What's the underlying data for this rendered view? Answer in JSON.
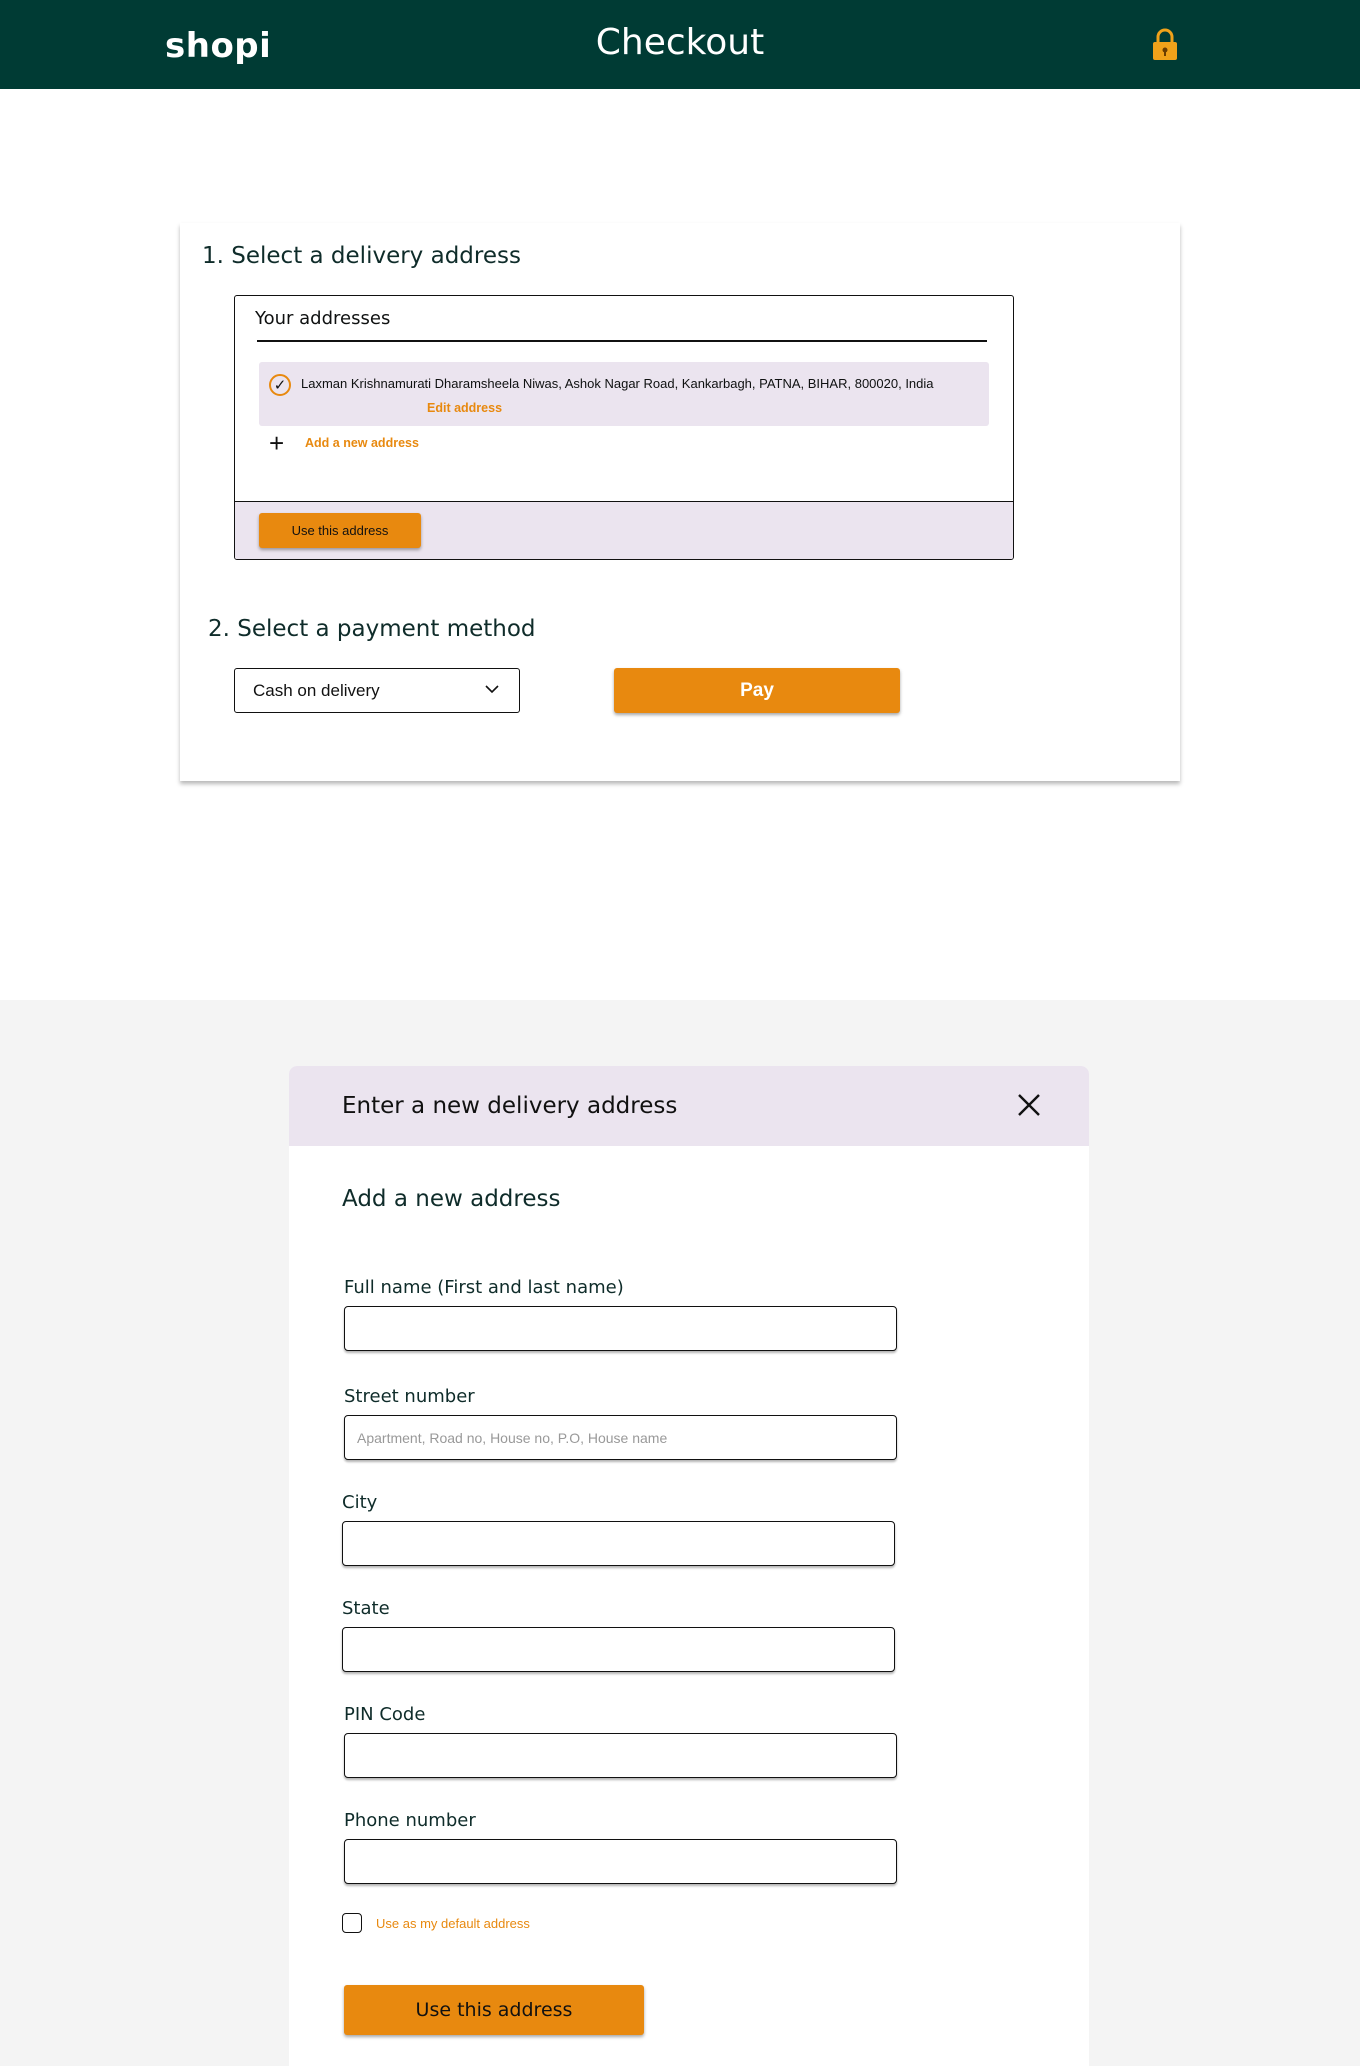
{
  "header": {
    "logo": "shopi",
    "title": "Checkout",
    "lock_icon": "lock-icon"
  },
  "checkout": {
    "step1_title": "1. Select  a delivery address",
    "addresses_heading": "Your addresses",
    "selected_address": "Laxman Krishnamurati Dharamsheela Niwas, Ashok Nagar Road, Kankarbagh, PATNA, BIHAR, 800020, India",
    "edit_link": "Edit address",
    "add_link": "Add a new address",
    "use_address_button": "Use this address",
    "step2_title": "2. Select a payment method",
    "payment_method": "Cash on delivery",
    "pay_button": "Pay"
  },
  "modal": {
    "title": "Enter a new delivery address",
    "subtitle": "Add a new address",
    "fields": {
      "full_name_label": "Full name (First and last name)",
      "street_label": "Street number",
      "street_placeholder": "Apartment, Road no, House no, P.O, House name",
      "city_label": "City",
      "state_label": "State",
      "pin_label": "PIN Code",
      "phone_label": "Phone number"
    },
    "default_checkbox_label": "Use as my default address",
    "submit_button": "Use this address"
  },
  "colors": {
    "header_bg": "#003b34",
    "accent": "#e8890f",
    "panel_tint": "#ebe4ef",
    "lower_bg": "#f4f4f4"
  }
}
